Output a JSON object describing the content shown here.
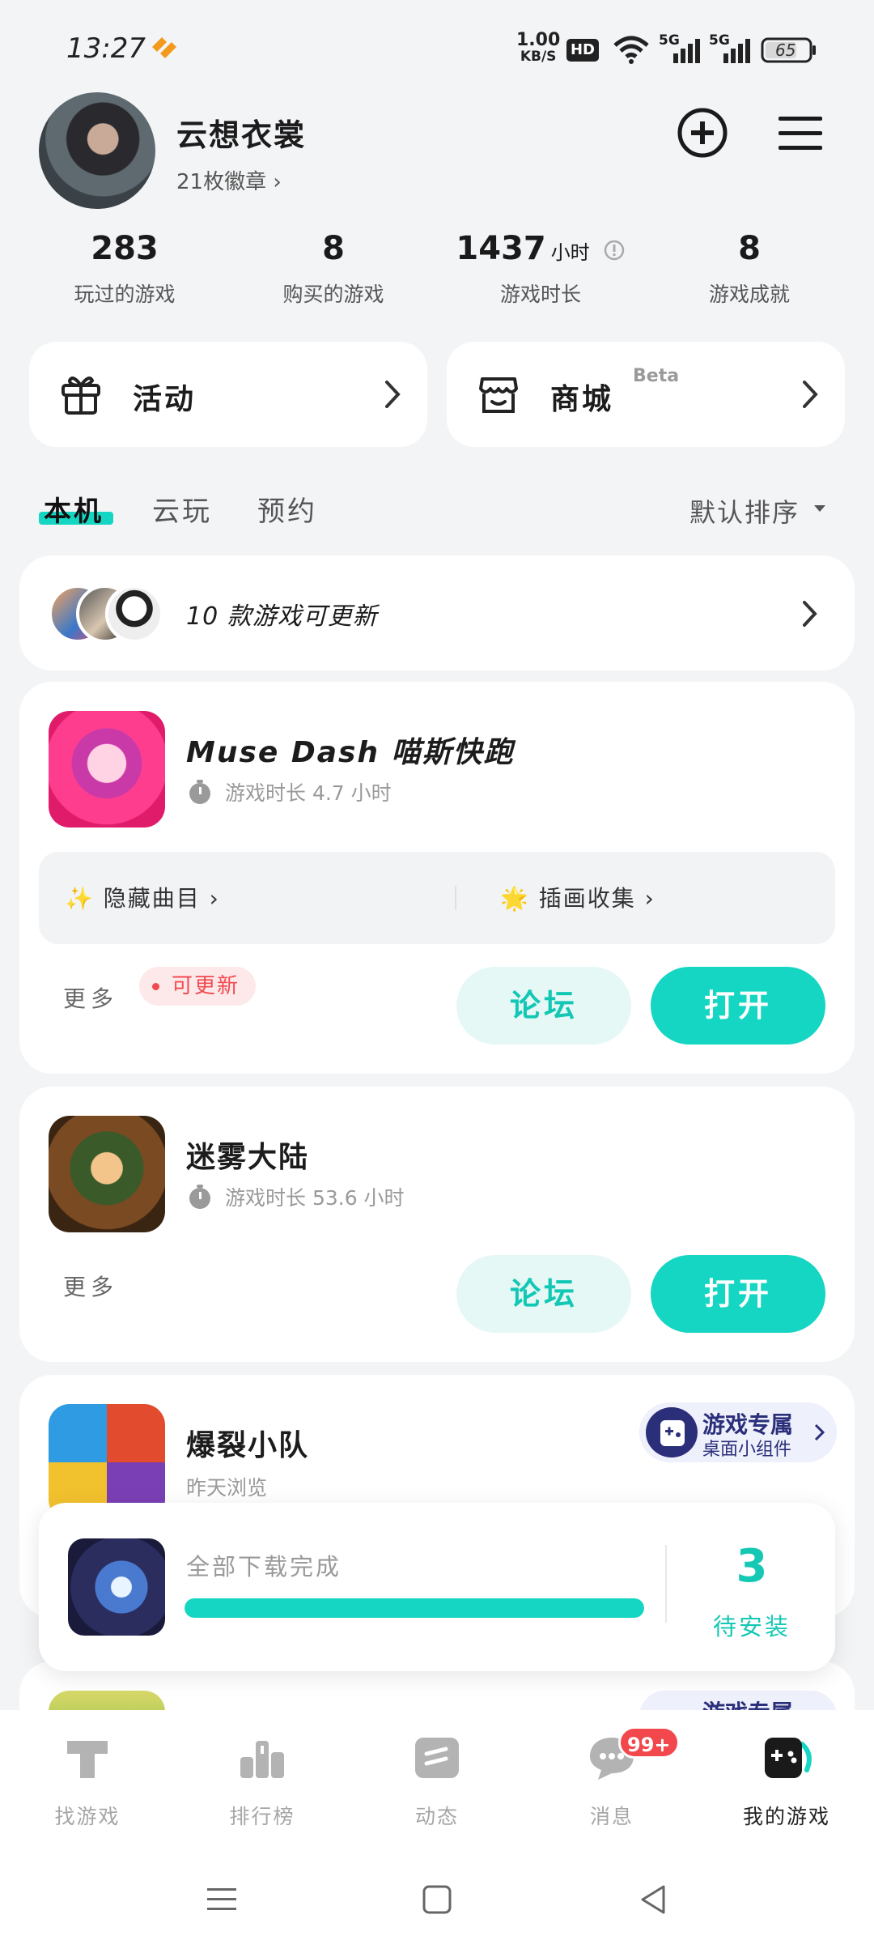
{
  "status_bar": {
    "time": "13:27",
    "speed_value": "1.00",
    "speed_unit": "KB/S",
    "hd_label": "HD",
    "signal1_label": "5G",
    "signal2_label": "5G",
    "battery": "65"
  },
  "profile": {
    "username": "云想衣裳",
    "badges": "21枚徽章 ›"
  },
  "stats": [
    {
      "value": "283",
      "unit": "",
      "label": "玩过的游戏"
    },
    {
      "value": "8",
      "unit": "",
      "label": "购买的游戏"
    },
    {
      "value": "1437",
      "unit": "小时",
      "label": "游戏时长"
    },
    {
      "value": "8",
      "unit": "",
      "label": "游戏成就"
    }
  ],
  "quick_cards": {
    "activity": "活动",
    "mall": "商城",
    "mall_badge": "Beta"
  },
  "tabs": [
    "本机",
    "云玩",
    "预约"
  ],
  "sort_label": "默认排序",
  "update_banner": "10 款游戏可更新",
  "games": [
    {
      "title": "Muse Dash 喵斯快跑",
      "meta": "游戏时长 4.7 小时",
      "tips": [
        "✨ 隐藏曲目 ›",
        "🌟 插画收集 ›"
      ],
      "more": "更多",
      "badge": "可更新",
      "forum": "论坛",
      "open": "打开"
    },
    {
      "title": "迷雾大陆",
      "meta": "游戏时长 53.6 小时",
      "more": "更多",
      "forum": "论坛",
      "open": "打开"
    },
    {
      "title": "爆裂小队",
      "meta": "昨天浏览",
      "widget_title": "游戏专属",
      "widget_sub": "桌面小组件"
    },
    {
      "widget_title": "游戏专属"
    }
  ],
  "download": {
    "text": "全部下载完成",
    "progress_fraction": 1.0,
    "count": "3",
    "label": "待安装"
  },
  "bottom_nav": [
    {
      "label": "找游戏",
      "icon": "find-games-icon"
    },
    {
      "label": "排行榜",
      "icon": "ranking-icon"
    },
    {
      "label": "动态",
      "icon": "feed-icon"
    },
    {
      "label": "消息",
      "icon": "message-icon",
      "badge": "99+"
    },
    {
      "label": "我的游戏",
      "icon": "my-games-icon",
      "active": true
    }
  ],
  "colors": {
    "accent": "#14d6c2",
    "badge_red": "#f24a4f",
    "background": "#f3f4f6"
  }
}
